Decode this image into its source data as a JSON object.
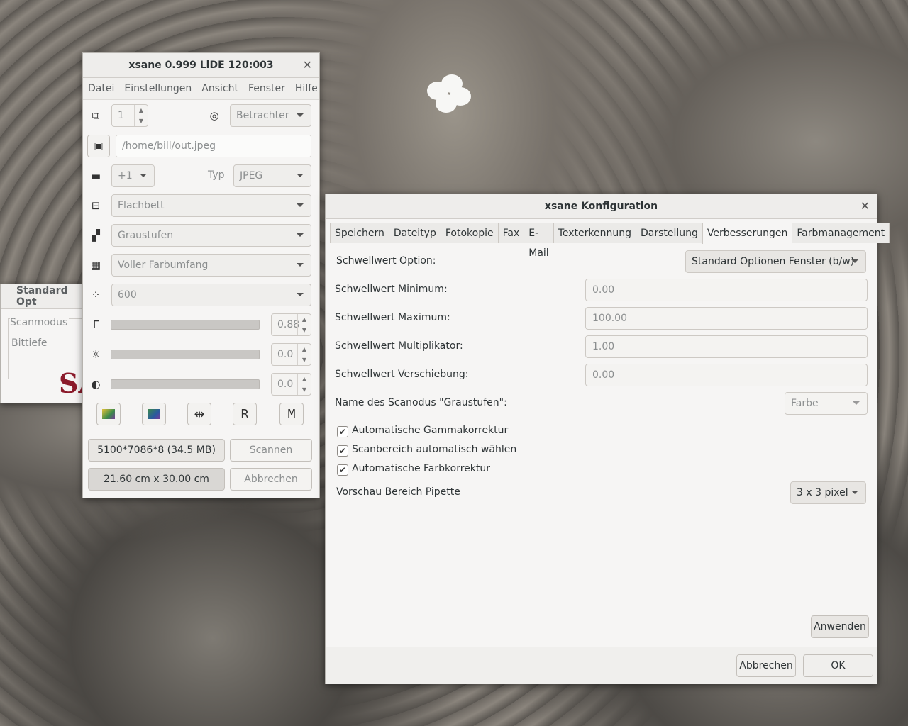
{
  "xsane": {
    "title": "xsane 0.999 LiDE 120:003",
    "menu": [
      "Datei",
      "Einstellungen",
      "Ansicht",
      "Fenster",
      "Hilfe"
    ],
    "copies": "1",
    "viewer": "Betrachter",
    "filename": "/home/bill/out.jpeg",
    "step": "+1",
    "type_label": "Typ",
    "type": "JPEG",
    "source": "Flachbett",
    "scanmode": "Graustufen",
    "color_range": "Voller Farbumfang",
    "resolution": "600",
    "gamma_value": "0.88",
    "brightness_value": "0.0",
    "contrast_value": "0.0",
    "size_info": "5100*7086*8 (34.5 MB)",
    "dim_info": "21.60 cm x 30.00 cm",
    "scan_button": "Scannen",
    "cancel_button": "Abbrechen"
  },
  "stdopt": {
    "title": "Standard Opt",
    "scanmode_label": "Scanmodus",
    "bitdepth_label": "Bittiefe",
    "logo": "SA"
  },
  "config": {
    "title": "xsane Konfiguration",
    "tabs": [
      "Speichern",
      "Dateityp",
      "Fotokopie",
      "Fax",
      "E-Mail",
      "Texterkennung",
      "Darstellung",
      "Verbesserungen",
      "Farbmanagement"
    ],
    "threshold_option_label": "Schwellwert Option:",
    "threshold_option_value": "Standard Optionen Fenster (b/w)",
    "threshold_min_label": "Schwellwert Minimum:",
    "threshold_min_value": "0.00",
    "threshold_max_label": "Schwellwert Maximum:",
    "threshold_max_value": "100.00",
    "threshold_mult_label": "Schwellwert Multiplikator:",
    "threshold_mult_value": "1.00",
    "threshold_shift_label": "Schwellwert Verschiebung:",
    "threshold_shift_value": "0.00",
    "scanmode_name_label": "Name des Scanodus \"Graustufen\":",
    "scanmode_name_value": "Farbe",
    "auto_gamma_label": "Automatische Gammakorrektur",
    "auto_area_label": "Scanbereich automatisch wählen",
    "auto_color_label": "Automatische Farbkorrektur",
    "pipette_label": "Vorschau Bereich Pipette",
    "pipette_value": "3 x 3 pixel",
    "apply_button": "Anwenden",
    "cancel_button": "Abbrechen",
    "ok_button": "OK"
  }
}
